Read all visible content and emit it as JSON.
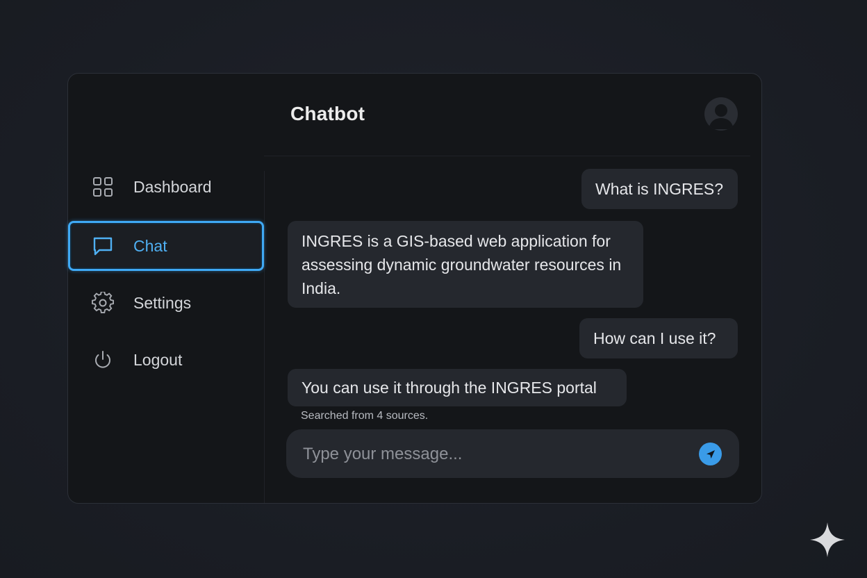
{
  "header": {
    "title": "Chatbot"
  },
  "sidebar": {
    "items": [
      {
        "label": "Dashboard",
        "icon": "grid-icon",
        "active": false
      },
      {
        "label": "Chat",
        "icon": "chat-bubble-icon",
        "active": true
      },
      {
        "label": "Settings",
        "icon": "gear-icon",
        "active": false
      },
      {
        "label": "Logout",
        "icon": "power-icon",
        "active": false
      }
    ]
  },
  "chat": {
    "messages": [
      {
        "role": "user",
        "text": "What is INGRES?"
      },
      {
        "role": "assistant",
        "text": "INGRES is a GIS-based web application for assessing dynamic groundwater resources in India."
      },
      {
        "role": "user",
        "text": "How can I use it?"
      },
      {
        "role": "assistant",
        "text": "You can use it through the INGRES portal"
      }
    ],
    "source_note": "Searched from 4 sources."
  },
  "composer": {
    "placeholder": "Type your message...",
    "value": ""
  },
  "colors": {
    "accent": "#3fa9f5",
    "page_background": "#1b1e25",
    "window_background": "#141619",
    "bubble_background": "#25282e",
    "send_button": "#3a9be8"
  }
}
